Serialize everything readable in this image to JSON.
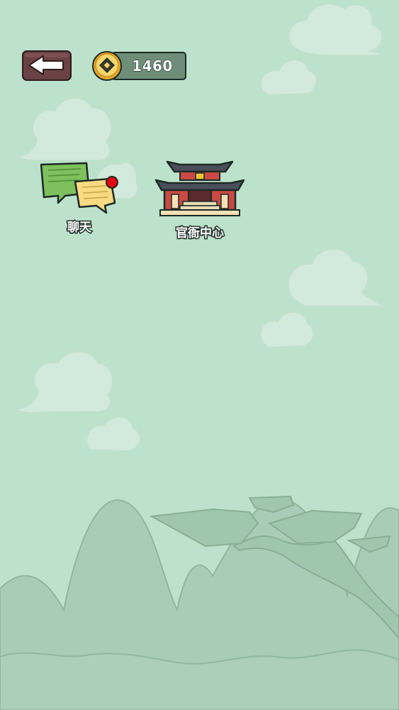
{
  "header": {
    "coins": "1460"
  },
  "features": [
    {
      "id": "chat",
      "label": "聊天",
      "has_notification": true
    },
    {
      "id": "office",
      "label": "官衙中心"
    }
  ],
  "icons": {
    "back": "arrow-left-icon",
    "coin": "coin-icon",
    "chat": "chat-bubbles-icon",
    "office": "government-building-icon",
    "notification": "red-dot-icon"
  },
  "colors": {
    "background": "#bde2cb",
    "back_button": "#6a4244",
    "coin_bar": "#6e8e7a",
    "coin_gold": "#f2c44c",
    "notification": "#e60012"
  }
}
